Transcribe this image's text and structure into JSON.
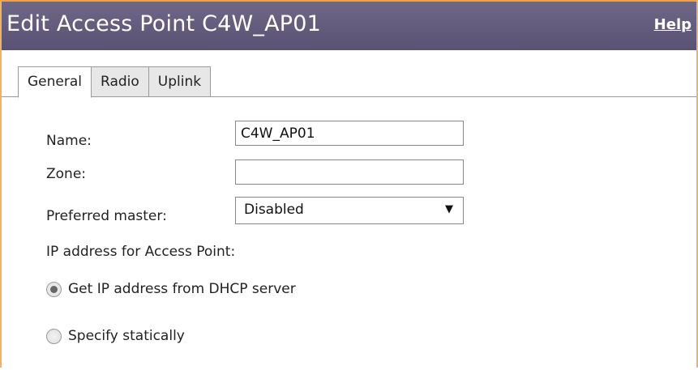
{
  "dialog": {
    "title": "Edit Access Point C4W_AP01",
    "help_label": "Help"
  },
  "tabs": [
    {
      "label": "General",
      "active": true
    },
    {
      "label": "Radio",
      "active": false
    },
    {
      "label": "Uplink",
      "active": false
    }
  ],
  "form": {
    "name_label": "Name:",
    "name_value": "C4W_AP01",
    "zone_label": "Zone:",
    "zone_value": "",
    "preferred_master_label": "Preferred master:",
    "preferred_master_value": "Disabled",
    "ip_section_label": "IP address for Access Point:",
    "ip_options": [
      {
        "label": "Get IP address from DHCP server",
        "checked": true
      },
      {
        "label": "Specify statically",
        "checked": false
      }
    ]
  },
  "colors": {
    "titlebar": "#5f5879",
    "frame_border": "#e9b46e"
  },
  "icons": {
    "dropdown": "chevron-down-icon"
  }
}
